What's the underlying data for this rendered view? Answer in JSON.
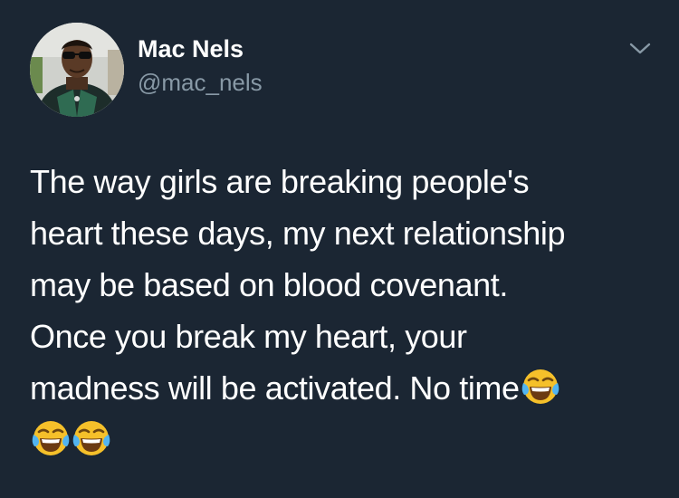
{
  "tweet": {
    "author": {
      "display_name": "Mac Nels",
      "handle": "@mac_nels",
      "avatar_icon": "profile-photo"
    },
    "menu_icon": "chevron-down-icon",
    "text_lines": [
      "The way girls are breaking people's",
      "heart these days, my next relationship",
      "may be based on blood covenant.",
      "Once you break my heart, your",
      "madness will be activated. No time"
    ],
    "emoji": "face-with-tears-of-joy",
    "emoji_count": 3
  },
  "colors": {
    "background": "#1b2633",
    "text": "#ffffff",
    "handle": "#8899a6",
    "chevron": "#8899a6"
  }
}
